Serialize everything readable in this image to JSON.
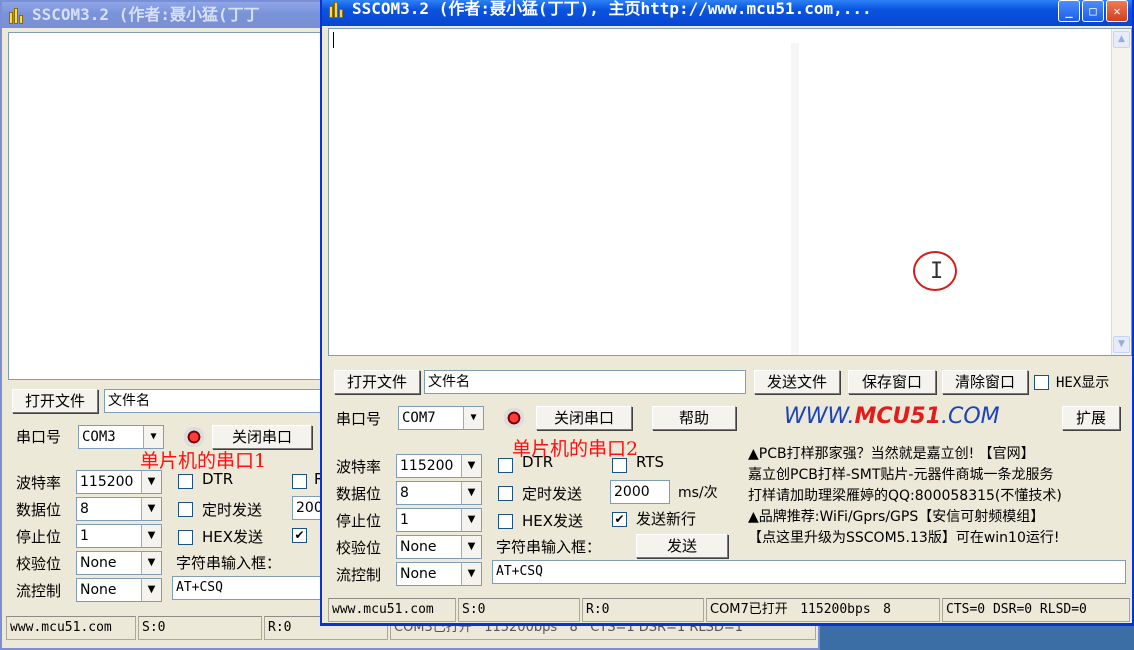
{
  "window_back": {
    "title": "SSCOM3.2 (作者:聂小猛(丁丁",
    "open_file_button": "打开文件",
    "file_name": "文件名",
    "port_label": "串口号",
    "port_value": "COM3",
    "close_port_button": "关闭串口",
    "baud_label": "波特率",
    "baud_value": "115200",
    "databits_label": "数据位",
    "databits_value": "8",
    "stopbits_label": "停止位",
    "stopbits_value": "1",
    "parity_label": "校验位",
    "parity_value": "None",
    "flow_label": "流控制",
    "flow_value": "None",
    "dtr_label": "DTR",
    "rts_label": "R",
    "timed_send_label": "定时发送",
    "interval_value": "200",
    "hex_send_label": "HEX发送",
    "input_label": "字符串输入框：",
    "send_text": "AT+CSQ",
    "status_site": "www.mcu51.com",
    "status_s": "S:0",
    "status_r": "R:0",
    "status_port": "COM3已打开",
    "status_baud": "115200bps",
    "status_bits": "8",
    "status_lines": "CTS=1 DSR=1 RLSD=1"
  },
  "window_front": {
    "title": "SSCOM3.2 (作者:聂小猛(丁丁), 主页http://www.mcu51.com,...",
    "open_file_button": "打开文件",
    "file_name": "文件名",
    "send_file_button": "发送文件",
    "save_window_button": "保存窗口",
    "clear_window_button": "清除窗口",
    "hex_display_label": "HEX显示",
    "port_label": "串口号",
    "port_value": "COM7",
    "close_port_button": "关闭串口",
    "help_button": "帮助",
    "logo_prefix": "WWW.",
    "logo_brand": "MCU51",
    "logo_suffix": ".COM",
    "expand_button": "扩展",
    "baud_label": "波特率",
    "baud_value": "115200",
    "databits_label": "数据位",
    "databits_value": "8",
    "stopbits_label": "停止位",
    "stopbits_value": "1",
    "parity_label": "校验位",
    "parity_value": "None",
    "flow_label": "流控制",
    "flow_value": "None",
    "dtr_label": "DTR",
    "rts_label": "RTS",
    "timed_send_label": "定时发送",
    "interval_value": "2000",
    "interval_unit": "ms/次",
    "hex_send_label": "HEX发送",
    "newline_label": "发送新行",
    "input_label": "字符串输入框：",
    "send_button": "发送",
    "send_text": "AT+CSQ",
    "ads": [
      "▲PCB打样那家强？当然就是嘉立创! 【官网】",
      "嘉立创PCB打样-SMT贴片-元器件商城一条龙服务",
      "打样请加助理梁雁婷的QQ:800058315(不懂技术)",
      "▲品牌推荐:WiFi/Gprs/GPS【安信可射频模组】",
      "【点这里升级为SSCOM5.13版】可在win10运行!"
    ],
    "status_site": "www.mcu51.com",
    "status_s": "S:0",
    "status_r": "R:0",
    "status_port": "COM7已打开",
    "status_baud": "115200bps",
    "status_bits": "8",
    "status_lines": "CTS=0 DSR=0 RLSD=0"
  },
  "annotations": {
    "serial1": "单片机的串口1",
    "serial2": "单片机的串口2"
  },
  "icons": {
    "app": "sscom-app-icon",
    "minimize": "minimize-icon",
    "maximize": "maximize-icon",
    "close": "close-icon",
    "cursor": "text-cursor-icon"
  }
}
